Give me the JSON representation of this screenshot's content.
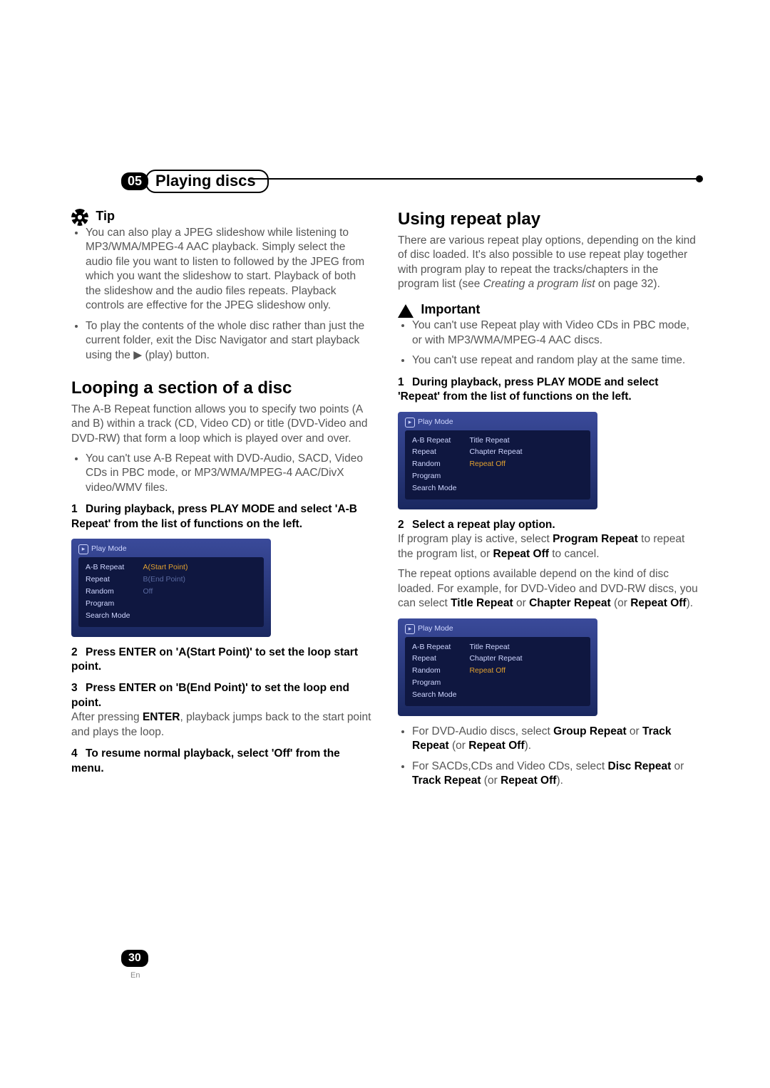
{
  "chapter": {
    "num": "05",
    "title": "Playing discs"
  },
  "tip": {
    "label": "Tip",
    "items": [
      "You can also play a JPEG slideshow while listening to MP3/WMA/MPEG-4 AAC playback. Simply select the audio file you want to listen to followed by the JPEG from which you want the slideshow to start. Playback of both the slideshow and the audio files repeats. Playback controls are effective for the JPEG slideshow only.",
      "To play the contents of the whole disc rather than just the current folder, exit the Disc Navigator and start playback using the ▶ (play) button."
    ]
  },
  "looping": {
    "heading": "Looping a section of a disc",
    "intro": "The A-B Repeat function allows you to specify two points (A and B) within a track (CD, Video CD) or title (DVD-Video and DVD-RW) that form a loop which is played over and over.",
    "note": "You can't use A-B Repeat with DVD-Audio, SACD, Video CDs in PBC mode, or MP3/WMA/MPEG-4 AAC/DivX video/WMV files.",
    "steps": {
      "s1": "During playback, press PLAY MODE and select 'A-B Repeat' from the list of functions on the left.",
      "s2": "Press ENTER on 'A(Start Point)' to set the loop start point.",
      "s3": "Press ENTER on 'B(End Point)' to set the loop end point.",
      "s3b_a": "After pressing ",
      "s3b_enter": "ENTER",
      "s3b_b": ", playback jumps back to the start point and plays the loop.",
      "s4": "To resume normal playback, select 'Off' from the menu."
    }
  },
  "repeat": {
    "heading": "Using repeat play",
    "intro_a": "There are various repeat play options, depending on the kind of disc loaded. It's also possible to use repeat play together with program play to repeat the tracks/chapters in the program list (see ",
    "intro_ref": "Creating a program list",
    "intro_b": " on page 32).",
    "important_label": "Important",
    "important_items": [
      "You can't use Repeat play with Video CDs in PBC mode, or with MP3/WMA/MPEG-4 AAC discs.",
      "You can't use repeat and random play at the same time."
    ],
    "steps": {
      "s1": "During playback, press PLAY MODE and select 'Repeat' from the list of functions on the left.",
      "s2": "Select a repeat play option."
    },
    "s2_body_a": "If program play is active, select ",
    "s2_pr": "Program Repeat",
    "s2_body_b": " to repeat the program list, or ",
    "s2_ro": "Repeat Off",
    "s2_body_c": " to cancel.",
    "s2_body2_a": "The repeat options available depend on the kind of disc loaded. For example, for DVD-Video and DVD-RW discs, you can select ",
    "s2_tr": "Title Repeat",
    "s2_or": " or ",
    "s2_cr": "Chapter Repeat",
    "s2_por": " (or ",
    "s2_ro2": "Repeat Off",
    "s2_close": ").",
    "bul": {
      "b1a": "For DVD-Audio discs, select ",
      "b1_gr": "Group Repeat",
      "b1_or": " or ",
      "b1_tr": "Track Repeat",
      "b1_por": " (or ",
      "b1_ro": "Repeat Off",
      "b1_close": ").",
      "b2a": "For SACDs,CDs and Video CDs, select ",
      "b2_dr": "Disc Repeat",
      "b2_or": " or ",
      "b2_tr": "Track Repeat",
      "b2_por": " (or ",
      "b2_ro": "Repeat Off",
      "b2_close": ")."
    }
  },
  "osd": {
    "title": "Play Mode",
    "left": [
      "A-B Repeat",
      "Repeat",
      "Random",
      "Program",
      "Search Mode"
    ],
    "ab_right": {
      "a": "A(Start Point)",
      "b": "B(End Point)",
      "off": "Off"
    },
    "rep_right": {
      "t": "Title Repeat",
      "c": "Chapter Repeat",
      "off": "Repeat Off"
    }
  },
  "page": {
    "num": "30",
    "lang": "En"
  }
}
